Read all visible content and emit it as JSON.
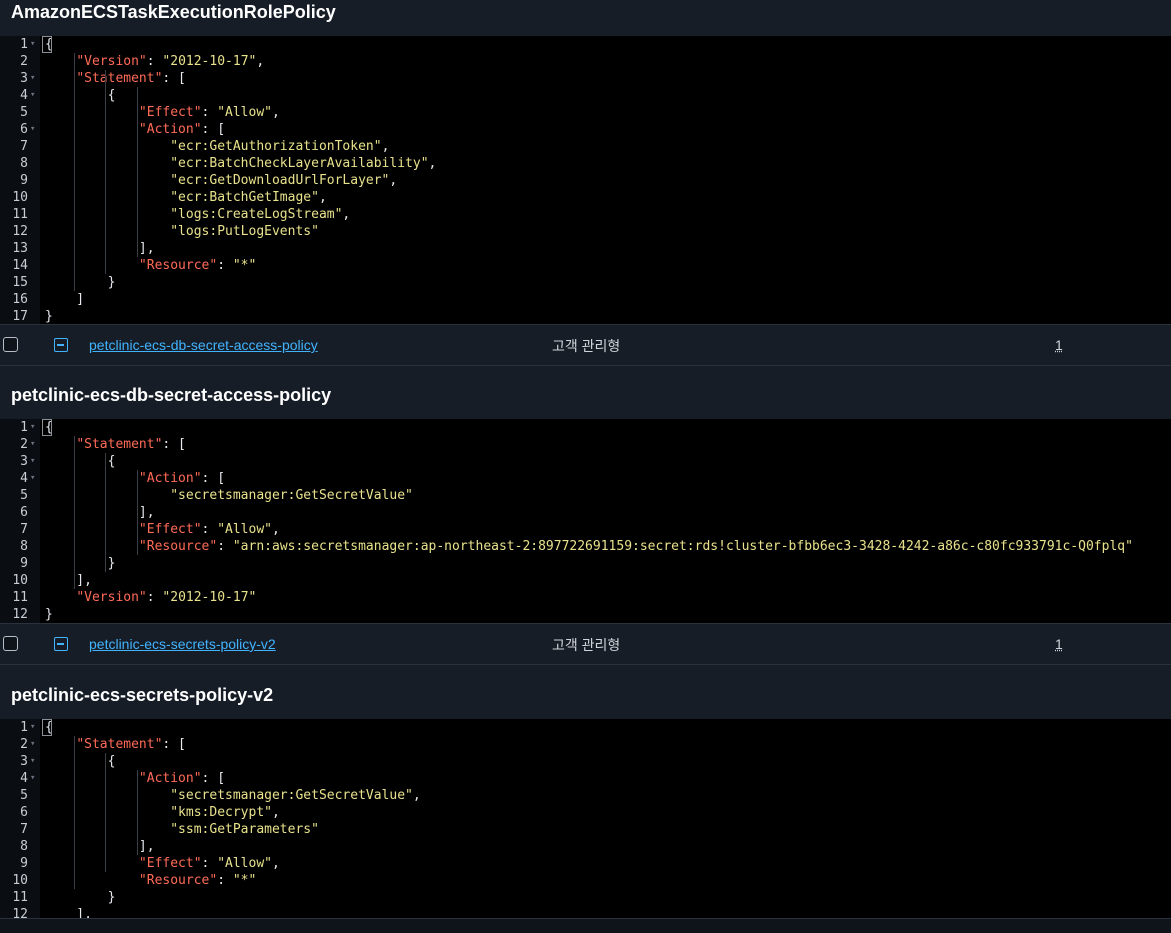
{
  "sections": [
    {
      "heading": "AmazonECSTaskExecutionRolePolicy"
    },
    {
      "heading": "petclinic-ecs-db-secret-access-policy"
    },
    {
      "heading": "petclinic-ecs-secrets-policy-v2"
    }
  ],
  "rows": [
    {
      "name": "petclinic-ecs-db-secret-access-policy",
      "type": "고객 관리형",
      "count": "1"
    },
    {
      "name": "petclinic-ecs-secrets-policy-v2",
      "type": "고객 관리형",
      "count": "1"
    }
  ],
  "code_blocks": [
    [
      {
        "n": "1",
        "fold": true,
        "t": [
          [
            "p",
            "{"
          ]
        ]
      },
      {
        "n": "2",
        "t": [
          [
            "p",
            "    "
          ],
          [
            "k",
            "\"Version\""
          ],
          [
            "p",
            ": "
          ],
          [
            "s",
            "\"2012-10-17\""
          ],
          [
            "p",
            ","
          ]
        ]
      },
      {
        "n": "3",
        "fold": true,
        "t": [
          [
            "p",
            "    "
          ],
          [
            "k",
            "\"Statement\""
          ],
          [
            "p",
            ": ["
          ]
        ]
      },
      {
        "n": "4",
        "fold": true,
        "t": [
          [
            "p",
            "        {"
          ]
        ]
      },
      {
        "n": "5",
        "t": [
          [
            "p",
            "            "
          ],
          [
            "k",
            "\"Effect\""
          ],
          [
            "p",
            ": "
          ],
          [
            "s",
            "\"Allow\""
          ],
          [
            "p",
            ","
          ]
        ]
      },
      {
        "n": "6",
        "fold": true,
        "t": [
          [
            "p",
            "            "
          ],
          [
            "k",
            "\"Action\""
          ],
          [
            "p",
            ": ["
          ]
        ]
      },
      {
        "n": "7",
        "t": [
          [
            "p",
            "                "
          ],
          [
            "s",
            "\"ecr:GetAuthorizationToken\""
          ],
          [
            "p",
            ","
          ]
        ]
      },
      {
        "n": "8",
        "t": [
          [
            "p",
            "                "
          ],
          [
            "s",
            "\"ecr:BatchCheckLayerAvailability\""
          ],
          [
            "p",
            ","
          ]
        ]
      },
      {
        "n": "9",
        "t": [
          [
            "p",
            "                "
          ],
          [
            "s",
            "\"ecr:GetDownloadUrlForLayer\""
          ],
          [
            "p",
            ","
          ]
        ]
      },
      {
        "n": "10",
        "t": [
          [
            "p",
            "                "
          ],
          [
            "s",
            "\"ecr:BatchGetImage\""
          ],
          [
            "p",
            ","
          ]
        ]
      },
      {
        "n": "11",
        "t": [
          [
            "p",
            "                "
          ],
          [
            "s",
            "\"logs:CreateLogStream\""
          ],
          [
            "p",
            ","
          ]
        ]
      },
      {
        "n": "12",
        "t": [
          [
            "p",
            "                "
          ],
          [
            "s",
            "\"logs:PutLogEvents\""
          ]
        ]
      },
      {
        "n": "13",
        "t": [
          [
            "p",
            "            ],"
          ]
        ]
      },
      {
        "n": "14",
        "t": [
          [
            "p",
            "            "
          ],
          [
            "k",
            "\"Resource\""
          ],
          [
            "p",
            ": "
          ],
          [
            "s",
            "\"*\""
          ]
        ]
      },
      {
        "n": "15",
        "t": [
          [
            "p",
            "        }"
          ]
        ]
      },
      {
        "n": "16",
        "t": [
          [
            "p",
            "    ]"
          ]
        ]
      },
      {
        "n": "17",
        "t": [
          [
            "p",
            "}"
          ]
        ]
      }
    ],
    [
      {
        "n": "1",
        "fold": true,
        "t": [
          [
            "p",
            "{"
          ]
        ]
      },
      {
        "n": "2",
        "fold": true,
        "t": [
          [
            "p",
            "    "
          ],
          [
            "k",
            "\"Statement\""
          ],
          [
            "p",
            ": ["
          ]
        ]
      },
      {
        "n": "3",
        "fold": true,
        "t": [
          [
            "p",
            "        {"
          ]
        ]
      },
      {
        "n": "4",
        "fold": true,
        "t": [
          [
            "p",
            "            "
          ],
          [
            "k",
            "\"Action\""
          ],
          [
            "p",
            ": ["
          ]
        ]
      },
      {
        "n": "5",
        "t": [
          [
            "p",
            "                "
          ],
          [
            "s",
            "\"secretsmanager:GetSecretValue\""
          ]
        ]
      },
      {
        "n": "6",
        "t": [
          [
            "p",
            "            ],"
          ]
        ]
      },
      {
        "n": "7",
        "t": [
          [
            "p",
            "            "
          ],
          [
            "k",
            "\"Effect\""
          ],
          [
            "p",
            ": "
          ],
          [
            "s",
            "\"Allow\""
          ],
          [
            "p",
            ","
          ]
        ]
      },
      {
        "n": "8",
        "t": [
          [
            "p",
            "            "
          ],
          [
            "k",
            "\"Resource\""
          ],
          [
            "p",
            ": "
          ],
          [
            "s",
            "\"arn:aws:secretsmanager:ap-northeast-2:897722691159:secret:rds!cluster-bfbb6ec3-3428-4242-a86c-c80fc933791c-Q0fplq\""
          ]
        ]
      },
      {
        "n": "9",
        "t": [
          [
            "p",
            "        }"
          ]
        ]
      },
      {
        "n": "10",
        "t": [
          [
            "p",
            "    ],"
          ]
        ]
      },
      {
        "n": "11",
        "t": [
          [
            "p",
            "    "
          ],
          [
            "k",
            "\"Version\""
          ],
          [
            "p",
            ": "
          ],
          [
            "s",
            "\"2012-10-17\""
          ]
        ]
      },
      {
        "n": "12",
        "t": [
          [
            "p",
            "}"
          ]
        ]
      }
    ],
    [
      {
        "n": "1",
        "fold": true,
        "t": [
          [
            "p",
            "{"
          ]
        ]
      },
      {
        "n": "2",
        "fold": true,
        "t": [
          [
            "p",
            "    "
          ],
          [
            "k",
            "\"Statement\""
          ],
          [
            "p",
            ": ["
          ]
        ]
      },
      {
        "n": "3",
        "fold": true,
        "t": [
          [
            "p",
            "        {"
          ]
        ]
      },
      {
        "n": "4",
        "fold": true,
        "t": [
          [
            "p",
            "            "
          ],
          [
            "k",
            "\"Action\""
          ],
          [
            "p",
            ": ["
          ]
        ]
      },
      {
        "n": "5",
        "t": [
          [
            "p",
            "                "
          ],
          [
            "s",
            "\"secretsmanager:GetSecretValue\""
          ],
          [
            "p",
            ","
          ]
        ]
      },
      {
        "n": "6",
        "t": [
          [
            "p",
            "                "
          ],
          [
            "s",
            "\"kms:Decrypt\""
          ],
          [
            "p",
            ","
          ]
        ]
      },
      {
        "n": "7",
        "t": [
          [
            "p",
            "                "
          ],
          [
            "s",
            "\"ssm:GetParameters\""
          ]
        ]
      },
      {
        "n": "8",
        "t": [
          [
            "p",
            "            ],"
          ]
        ]
      },
      {
        "n": "9",
        "t": [
          [
            "p",
            "            "
          ],
          [
            "k",
            "\"Effect\""
          ],
          [
            "p",
            ": "
          ],
          [
            "s",
            "\"Allow\""
          ],
          [
            "p",
            ","
          ]
        ]
      },
      {
        "n": "10",
        "t": [
          [
            "p",
            "            "
          ],
          [
            "k",
            "\"Resource\""
          ],
          [
            "p",
            ": "
          ],
          [
            "s",
            "\"*\""
          ]
        ]
      },
      {
        "n": "11",
        "t": [
          [
            "p",
            "        }"
          ]
        ]
      },
      {
        "n": "12",
        "t": [
          [
            "p",
            "    ],"
          ]
        ]
      }
    ]
  ],
  "colors": {
    "key": "#ff6b57",
    "string": "#e8e28c",
    "link": "#42b4ff",
    "background": "#0f141a",
    "editor": "#000000"
  },
  "icons": [
    "checkbox",
    "collapse-minus-icon"
  ]
}
